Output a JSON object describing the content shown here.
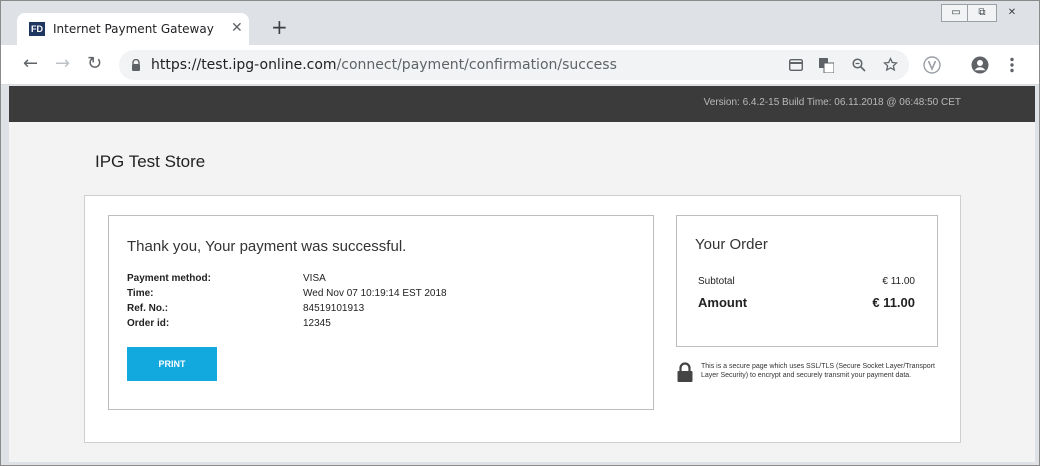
{
  "browser": {
    "tab": {
      "favicon_text": "FD",
      "title": "Internet Payment Gateway",
      "close": "✕"
    },
    "new_tab": "+",
    "window_controls": {
      "minimize": "▭",
      "restore": "⧉",
      "close": "✕"
    },
    "nav": {
      "back": "←",
      "forward": "→",
      "reload": "↻"
    },
    "url": {
      "prefix": "https://",
      "host": "test.ipg-online.com",
      "path": "/connect/payment/confirmation/success"
    },
    "icons": [
      "card-icon",
      "translate-icon",
      "zoom-icon",
      "star-icon",
      "extension-v-icon",
      "profile-icon",
      "menu-icon"
    ]
  },
  "header": {
    "version": "Version: 6.4.2-15 Build Time: 06.11.2018 @ 06:48:50 CET"
  },
  "store": {
    "name": "IPG Test Store"
  },
  "confirmation": {
    "message": "Thank you, Your payment was successful.",
    "details": [
      {
        "label": "Payment method:",
        "value": "VISA"
      },
      {
        "label": "Time:",
        "value": "Wed Nov 07 10:19:14 EST 2018"
      },
      {
        "label": "Ref. No.:",
        "value": "84519101913"
      },
      {
        "label": "Order id:",
        "value": "12345"
      }
    ],
    "print_label": "PRINT"
  },
  "order": {
    "title": "Your Order",
    "subtotal_label": "Subtotal",
    "subtotal_value": "€ 11.00",
    "amount_label": "Amount",
    "amount_value": "€ 11.00"
  },
  "security_note": "This is a secure page which uses SSL/TLS (Secure Socket Layer/Transport Layer Security) to encrypt and securely transmit your payment data.",
  "colors": {
    "header_bar": "#3b3b3b",
    "print_button": "#12a9df",
    "favicon": "#1f3660"
  }
}
